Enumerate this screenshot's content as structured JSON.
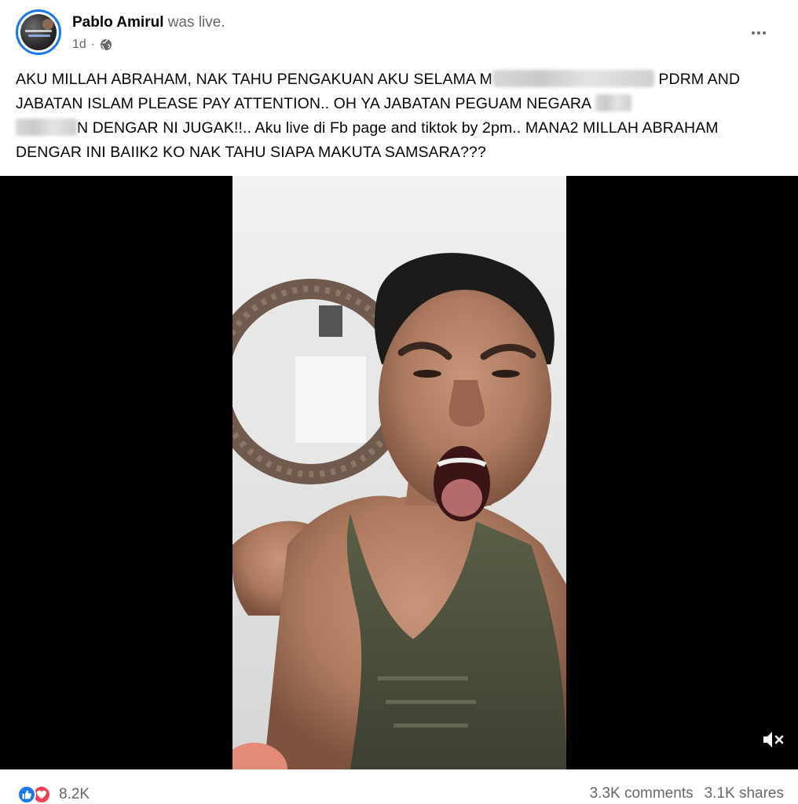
{
  "post": {
    "author": "Pablo Amirul",
    "action": "was live.",
    "time": "1d",
    "separator": "·",
    "privacy_icon": "globe-icon",
    "more_icon": "more-horizontal-icon",
    "text": {
      "part1": "AKU MILLAH ABRAHAM, NAK TAHU PENGAKUAN AKU SELAMA M",
      "part2": " PDRM AND JABATAN ISLAM PLEASE PAY ATTENTION.. OH YA JABATAN PEGUAM NEGARA ",
      "part3": "N DENGAR NI JUGAK!!.. Aku live di Fb page and tiktok by 2pm.. MANA2 MILLAH ABRAHAM DENGAR INI BAIIK2 KO NAK TAHU SIAPA MAKUTA SAMSARA???"
    }
  },
  "video": {
    "mute_icon": "volume-muted-icon"
  },
  "footer": {
    "reaction_icons": [
      "like-icon",
      "love-icon"
    ],
    "reaction_count": "8.2K",
    "comments": "3.3K comments",
    "shares": "3.1K shares"
  },
  "colors": {
    "accent": "#1877f2",
    "love": "#f33e58",
    "secondary_text": "#65676b",
    "video_bg": "#000000"
  }
}
